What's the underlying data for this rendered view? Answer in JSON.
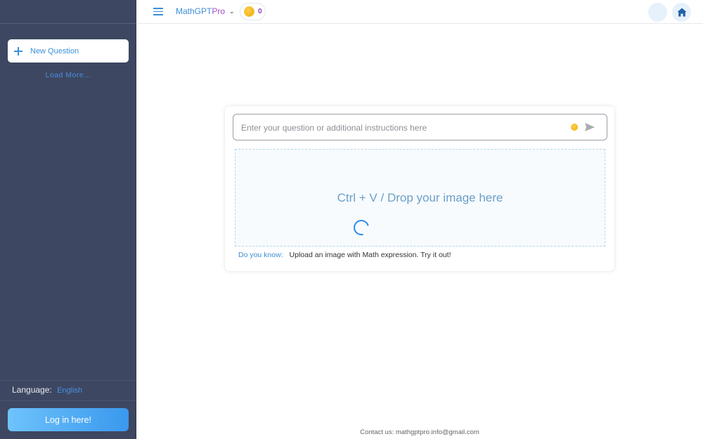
{
  "sidebar": {
    "new_question_label": "New Question",
    "load_more_label": "Load More...",
    "language_label": "Language:",
    "language_value": "English",
    "login_label": "Log in here!"
  },
  "topbar": {
    "brand_part1": "MathGPT",
    "brand_part2": "Pro",
    "coin_count": "0",
    "colors": {
      "brand_blue": "#3b8fd9",
      "brand_purple": "#a24fd0"
    }
  },
  "main": {
    "question_placeholder": "Enter your question or additional instructions here",
    "question_value": "",
    "drop_text": "Ctrl + V / Drop your image here",
    "tip_label": "Do you know:",
    "tip_text": "Upload an image with Math expression. Try it out!"
  },
  "footer": {
    "contact": "Contact us: mathgptpro.info@gmail.com"
  },
  "icons": [
    "plus-icon",
    "menu-icon",
    "chevron-down-icon",
    "coin-icon",
    "home-icon",
    "send-icon",
    "loading-spinner"
  ]
}
